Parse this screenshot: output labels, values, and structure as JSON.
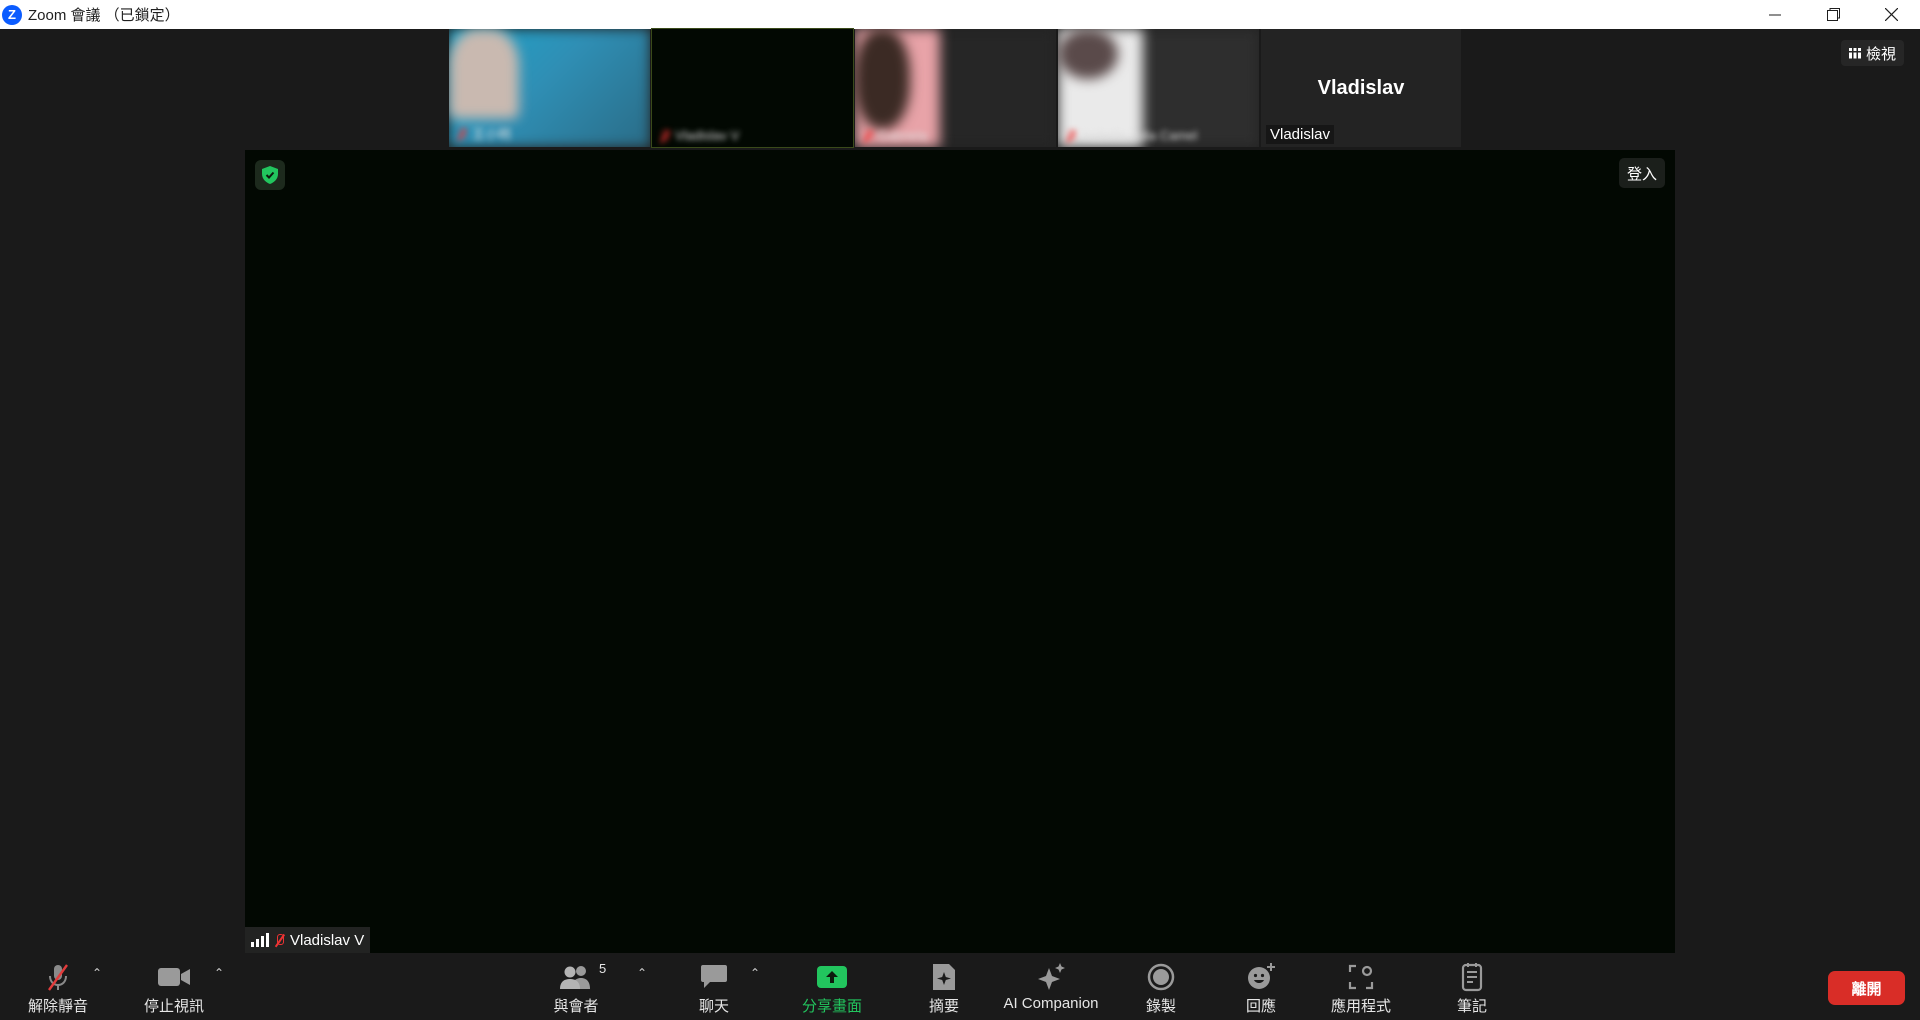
{
  "window": {
    "title": "Zoom 會議 （已鎖定）",
    "logo_letter": "Z",
    "controls": [
      "minimize",
      "restore",
      "close"
    ]
  },
  "strip": {
    "thumbnails": [
      {
        "name": "王小明",
        "bg": "#3a9ec4"
      },
      {
        "name": "Vladislav V",
        "bg": "#020802"
      },
      {
        "name": "Gabriela",
        "bg": "#2a2a2a"
      },
      {
        "name": "Isabella Julia Camel",
        "bg": "#3b3b3b"
      }
    ],
    "active": {
      "big_name": "Vladislav",
      "small_name": "Vladislav"
    }
  },
  "view_button": {
    "label": "檢視"
  },
  "main_video": {
    "signin_label": "登入",
    "speaker_name": "Vladislav V"
  },
  "toolbar": {
    "unmute": "解除靜音",
    "stop_video": "停止視訊",
    "participants": "與會者",
    "participants_count": "5",
    "chat": "聊天",
    "share": "分享畫面",
    "summary": "摘要",
    "ai_companion": "AI Companion",
    "record": "錄製",
    "reactions": "回應",
    "apps": "應用程式",
    "notes": "筆記",
    "leave": "離開"
  },
  "colors": {
    "accent_green": "#22c55e",
    "leave_red": "#d92d27",
    "zoom_blue": "#0b5cff"
  }
}
